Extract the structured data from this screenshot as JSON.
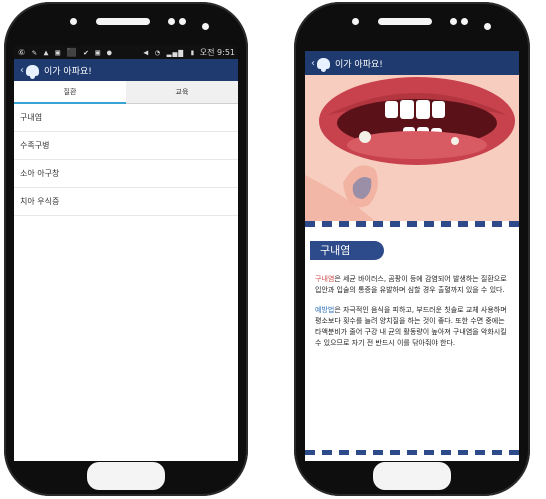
{
  "left_screen": {
    "status": {
      "left_glyphs": "⑥ ✎ ▲ ▣ ⬛ ✔ ▣ ●",
      "time": "오전 9:51"
    },
    "appbar": {
      "title": "이가 아파요!"
    },
    "tabs": [
      {
        "label": "질환",
        "active": true
      },
      {
        "label": "교육",
        "active": false
      }
    ],
    "items": [
      "구내염",
      "수족구병",
      "소아 아구창",
      "치아 우식증"
    ]
  },
  "right_screen": {
    "appbar": {
      "title": "이가 아파요!"
    },
    "heading": "구내염",
    "paragraph1": {
      "keyword": "구내염",
      "text": "은 세균 바이러스, 곰팡이 등에 감염되어 발생하는 질환으로 입안과 입술의 통증을 유발하며 심할 경우 출혈까지 있을 수 있다."
    },
    "paragraph2": {
      "keyword": "예방법",
      "text": "은 자극적인 음식을 피하고, 부드러운 칫솔로 교체 사용하며 평소보다 횟수를 늘려 양치질을 하는 것이 좋다. 또한 수면 중에는 타액분비가 줄어 구강 내 균의 활동량이 높아져 구내염을 악화시킬 수 있으므로 자기 전 반드시 이를 닦아줘야 한다."
    }
  },
  "colors": {
    "appbar": "#1e3a6e",
    "tab_indicator": "#3aa3d6",
    "accent_blue": "#2d4a8a",
    "keyword_red": "#d14b4b",
    "keyword_blue": "#2d6fb8"
  }
}
